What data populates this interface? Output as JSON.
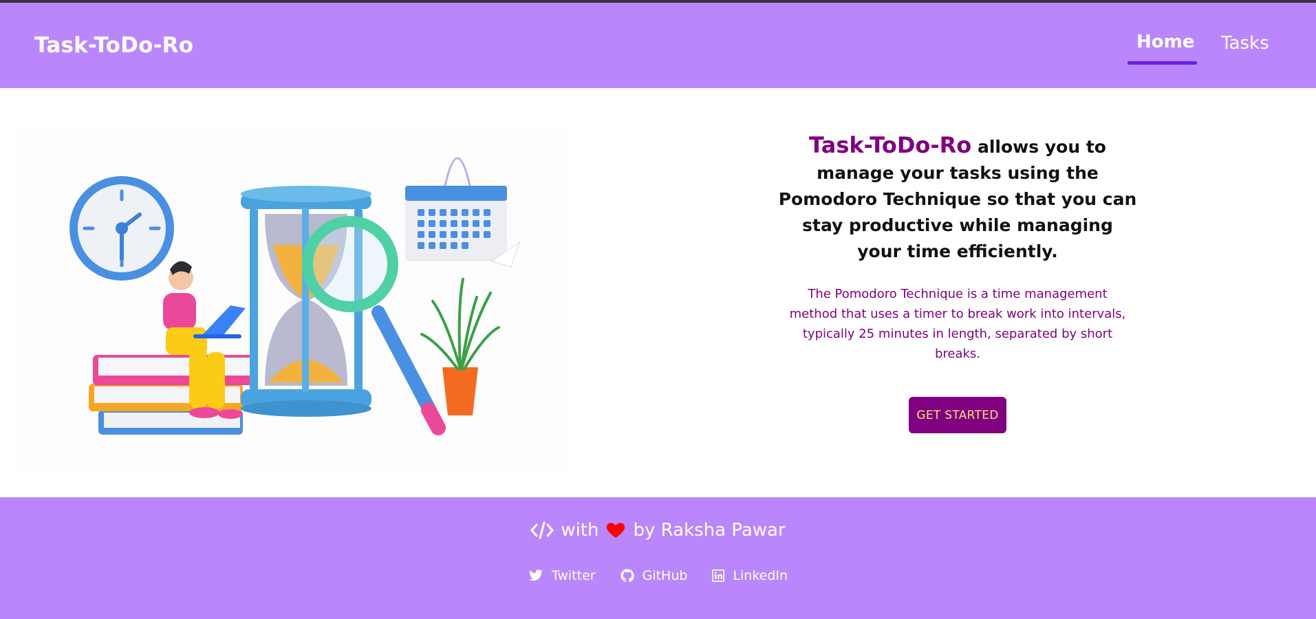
{
  "app": {
    "brand": "Task-ToDo-Ro"
  },
  "nav": {
    "items": [
      {
        "label": "Home",
        "active": true
      },
      {
        "label": "Tasks",
        "active": false
      }
    ]
  },
  "hero": {
    "headline_brand": "Task-ToDo-Ro",
    "headline_rest": "allows you to manage your tasks using the Pomodoro Technique so that you can stay productive while managing your time efficiently.",
    "description": "The Pomodoro Technique is a time management method that uses a timer to break work into intervals, typically 25 minutes in length, separated by short breaks.",
    "cta_label": "GET STARTED"
  },
  "footer": {
    "credit_with": "with",
    "credit_by": "by Raksha Pawar",
    "links": [
      {
        "label": "Twitter",
        "icon": "twitter-icon"
      },
      {
        "label": "GitHub",
        "icon": "github-icon"
      },
      {
        "label": "LinkedIn",
        "icon": "linkedin-icon"
      }
    ]
  },
  "colors": {
    "nav_bg": "#b987fb",
    "accent_purple": "#800080",
    "active_underline": "#6a1ee6",
    "cta_text": "#f5e27a",
    "heart": "#ff0000"
  }
}
